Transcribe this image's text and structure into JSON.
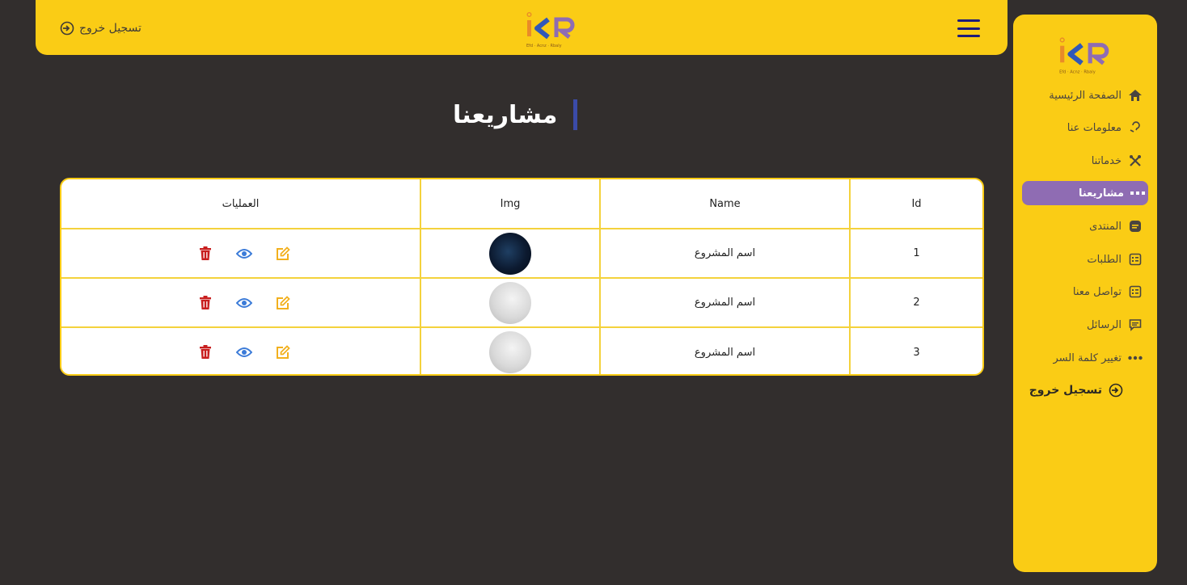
{
  "topbar": {
    "logout_label": "تسجيل خروج",
    "logo": "icr-logo",
    "menu_icon": "hamburger-icon"
  },
  "sidebar": {
    "items": [
      {
        "label": "الصفحة الرئيسية",
        "icon": "home-icon",
        "active": false
      },
      {
        "label": "معلومات عنا",
        "icon": "question-icon",
        "active": false
      },
      {
        "label": "خدماتنا",
        "icon": "tools-icon",
        "active": false
      },
      {
        "label": "مشاريعنا",
        "icon": "dots-icon",
        "active": true
      },
      {
        "label": "المنتدى",
        "icon": "book-icon",
        "active": false
      },
      {
        "label": "الطلبات",
        "icon": "list-icon",
        "active": false
      },
      {
        "label": "تواصل معنا",
        "icon": "contact-icon",
        "active": false
      },
      {
        "label": "الرسائل",
        "icon": "message-icon",
        "active": false
      },
      {
        "label": "تغيير كلمة السر",
        "icon": "password-icon",
        "active": false
      }
    ],
    "logout_label": "تسجيل خروج"
  },
  "page": {
    "title": "مشاريعنا"
  },
  "table": {
    "headers": {
      "id": "Id",
      "name": "Name",
      "img": "Img",
      "ops": "العمليات"
    },
    "rows": [
      {
        "id": "1",
        "name": "اسم المشروع",
        "img": "dark"
      },
      {
        "id": "2",
        "name": "اسم المشروع",
        "img": "light"
      },
      {
        "id": "3",
        "name": "اسم المشروع",
        "img": "light"
      }
    ]
  },
  "colors": {
    "background": "#322e2d",
    "accent_yellow": "#facc15",
    "active_purple": "#8f6cb3",
    "edit": "#f2b01e",
    "view": "#3b7bd8",
    "delete": "#c81e1e"
  }
}
